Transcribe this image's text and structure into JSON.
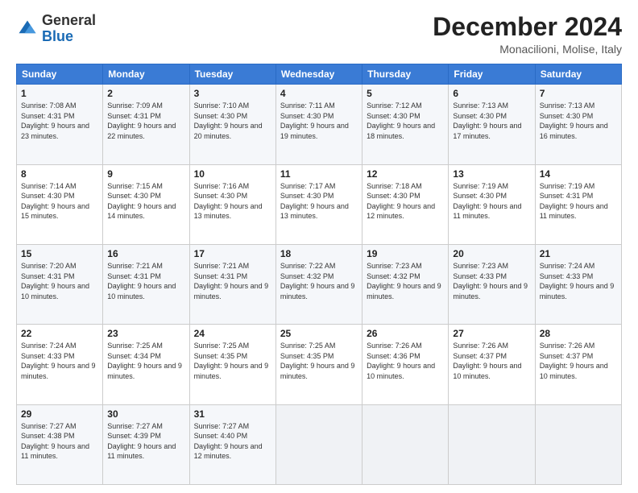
{
  "header": {
    "logo": {
      "general": "General",
      "blue": "Blue"
    },
    "title": "December 2024",
    "location": "Monacilioni, Molise, Italy"
  },
  "weekdays": [
    "Sunday",
    "Monday",
    "Tuesday",
    "Wednesday",
    "Thursday",
    "Friday",
    "Saturday"
  ],
  "weeks": [
    [
      {
        "day": "1",
        "sunrise": "7:08 AM",
        "sunset": "4:31 PM",
        "daylight": "9 hours and 23 minutes."
      },
      {
        "day": "2",
        "sunrise": "7:09 AM",
        "sunset": "4:31 PM",
        "daylight": "9 hours and 22 minutes."
      },
      {
        "day": "3",
        "sunrise": "7:10 AM",
        "sunset": "4:30 PM",
        "daylight": "9 hours and 20 minutes."
      },
      {
        "day": "4",
        "sunrise": "7:11 AM",
        "sunset": "4:30 PM",
        "daylight": "9 hours and 19 minutes."
      },
      {
        "day": "5",
        "sunrise": "7:12 AM",
        "sunset": "4:30 PM",
        "daylight": "9 hours and 18 minutes."
      },
      {
        "day": "6",
        "sunrise": "7:13 AM",
        "sunset": "4:30 PM",
        "daylight": "9 hours and 17 minutes."
      },
      {
        "day": "7",
        "sunrise": "7:13 AM",
        "sunset": "4:30 PM",
        "daylight": "9 hours and 16 minutes."
      }
    ],
    [
      {
        "day": "8",
        "sunrise": "7:14 AM",
        "sunset": "4:30 PM",
        "daylight": "9 hours and 15 minutes."
      },
      {
        "day": "9",
        "sunrise": "7:15 AM",
        "sunset": "4:30 PM",
        "daylight": "9 hours and 14 minutes."
      },
      {
        "day": "10",
        "sunrise": "7:16 AM",
        "sunset": "4:30 PM",
        "daylight": "9 hours and 13 minutes."
      },
      {
        "day": "11",
        "sunrise": "7:17 AM",
        "sunset": "4:30 PM",
        "daylight": "9 hours and 13 minutes."
      },
      {
        "day": "12",
        "sunrise": "7:18 AM",
        "sunset": "4:30 PM",
        "daylight": "9 hours and 12 minutes."
      },
      {
        "day": "13",
        "sunrise": "7:19 AM",
        "sunset": "4:30 PM",
        "daylight": "9 hours and 11 minutes."
      },
      {
        "day": "14",
        "sunrise": "7:19 AM",
        "sunset": "4:31 PM",
        "daylight": "9 hours and 11 minutes."
      }
    ],
    [
      {
        "day": "15",
        "sunrise": "7:20 AM",
        "sunset": "4:31 PM",
        "daylight": "9 hours and 10 minutes."
      },
      {
        "day": "16",
        "sunrise": "7:21 AM",
        "sunset": "4:31 PM",
        "daylight": "9 hours and 10 minutes."
      },
      {
        "day": "17",
        "sunrise": "7:21 AM",
        "sunset": "4:31 PM",
        "daylight": "9 hours and 9 minutes."
      },
      {
        "day": "18",
        "sunrise": "7:22 AM",
        "sunset": "4:32 PM",
        "daylight": "9 hours and 9 minutes."
      },
      {
        "day": "19",
        "sunrise": "7:23 AM",
        "sunset": "4:32 PM",
        "daylight": "9 hours and 9 minutes."
      },
      {
        "day": "20",
        "sunrise": "7:23 AM",
        "sunset": "4:33 PM",
        "daylight": "9 hours and 9 minutes."
      },
      {
        "day": "21",
        "sunrise": "7:24 AM",
        "sunset": "4:33 PM",
        "daylight": "9 hours and 9 minutes."
      }
    ],
    [
      {
        "day": "22",
        "sunrise": "7:24 AM",
        "sunset": "4:33 PM",
        "daylight": "9 hours and 9 minutes."
      },
      {
        "day": "23",
        "sunrise": "7:25 AM",
        "sunset": "4:34 PM",
        "daylight": "9 hours and 9 minutes."
      },
      {
        "day": "24",
        "sunrise": "7:25 AM",
        "sunset": "4:35 PM",
        "daylight": "9 hours and 9 minutes."
      },
      {
        "day": "25",
        "sunrise": "7:25 AM",
        "sunset": "4:35 PM",
        "daylight": "9 hours and 9 minutes."
      },
      {
        "day": "26",
        "sunrise": "7:26 AM",
        "sunset": "4:36 PM",
        "daylight": "9 hours and 10 minutes."
      },
      {
        "day": "27",
        "sunrise": "7:26 AM",
        "sunset": "4:37 PM",
        "daylight": "9 hours and 10 minutes."
      },
      {
        "day": "28",
        "sunrise": "7:26 AM",
        "sunset": "4:37 PM",
        "daylight": "9 hours and 10 minutes."
      }
    ],
    [
      {
        "day": "29",
        "sunrise": "7:27 AM",
        "sunset": "4:38 PM",
        "daylight": "9 hours and 11 minutes."
      },
      {
        "day": "30",
        "sunrise": "7:27 AM",
        "sunset": "4:39 PM",
        "daylight": "9 hours and 11 minutes."
      },
      {
        "day": "31",
        "sunrise": "7:27 AM",
        "sunset": "4:40 PM",
        "daylight": "9 hours and 12 minutes."
      },
      null,
      null,
      null,
      null
    ]
  ],
  "labels": {
    "sunrise": "Sunrise:",
    "sunset": "Sunset:",
    "daylight": "Daylight:"
  }
}
